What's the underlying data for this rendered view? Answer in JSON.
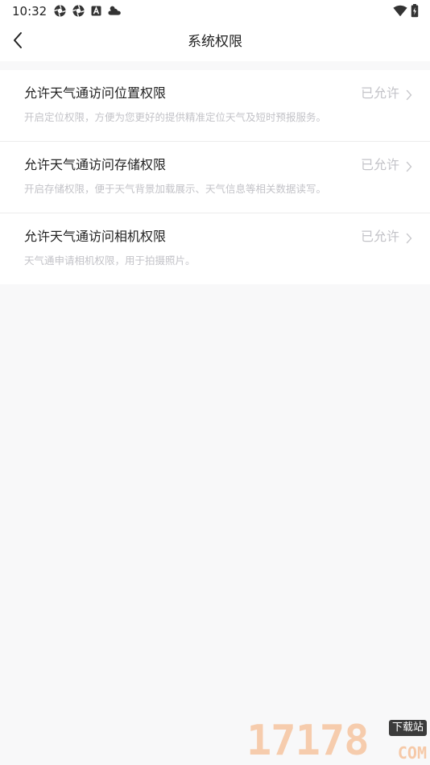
{
  "status_bar": {
    "time": "10:32",
    "left_icons": [
      "aperture-icon",
      "aperture-icon",
      "a-badge-icon",
      "weather-cloud-icon"
    ],
    "right_icons": [
      "wifi-icon",
      "battery-charging-icon"
    ]
  },
  "nav": {
    "title": "系统权限",
    "back_icon": "chevron-left-icon"
  },
  "permissions": [
    {
      "title": "允许天气通访问位置权限",
      "description": "开启定位权限，方便为您更好的提供精准定位天气及短时预报服务。",
      "status": "已允许"
    },
    {
      "title": "允许天气通访问存储权限",
      "description": "开启存储权限，便于天气背景加载展示、天气信息等相关数据读写。",
      "status": "已允许"
    },
    {
      "title": "允许天气通访问相机权限",
      "description": "天气通申请相机权限，用于拍摄照片。",
      "status": "已允许"
    }
  ],
  "watermark": {
    "digits": "17178",
    "tag": "下载站",
    "suffix": "COM"
  },
  "colors": {
    "background": "#f8f8f9",
    "card": "#ffffff",
    "title_text": "#222222",
    "muted_text": "#c3c3c8",
    "divider": "#ececec"
  }
}
